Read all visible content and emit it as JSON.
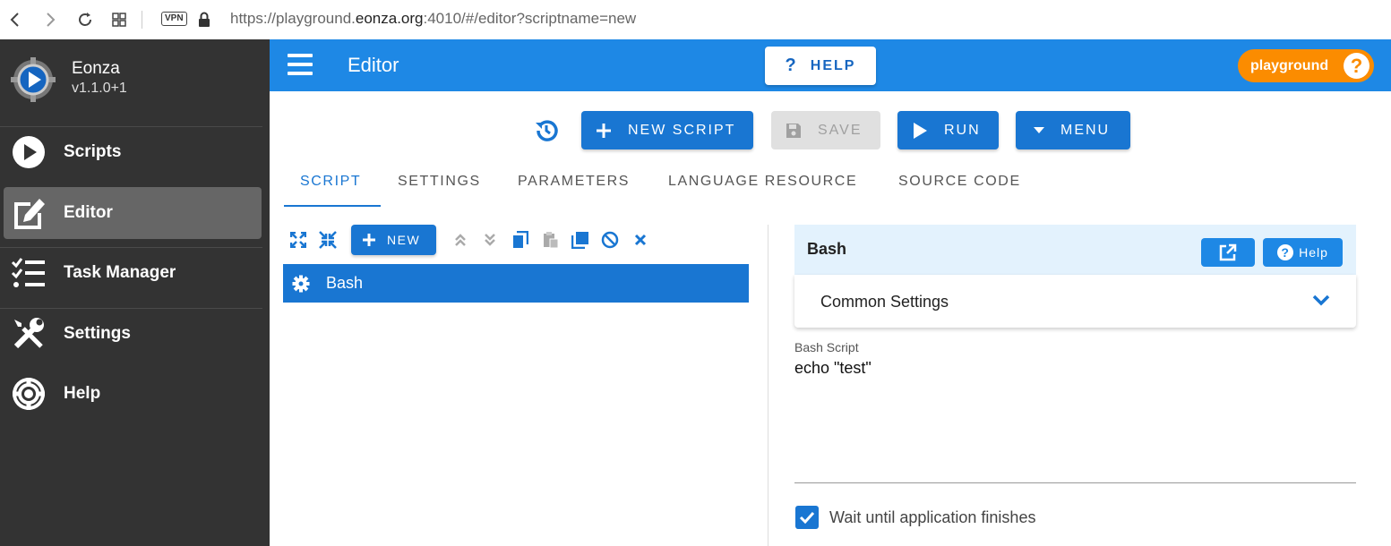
{
  "browser": {
    "url_prefix": "https://playground.",
    "url_domain": "eonza.org",
    "url_suffix": ":4010/#/editor?scriptname=new",
    "vpn_label": "VPN"
  },
  "app": {
    "name": "Eonza",
    "version": "v1.1.0+1"
  },
  "sidebar": {
    "items": [
      {
        "label": "Scripts",
        "icon": "play-circle-icon",
        "active": false
      },
      {
        "label": "Editor",
        "icon": "edit-icon",
        "active": true
      },
      {
        "label": "Task Manager",
        "icon": "checklist-icon",
        "active": false
      },
      {
        "label": "Settings",
        "icon": "tools-icon",
        "active": false
      },
      {
        "label": "Help",
        "icon": "lifebuoy-icon",
        "active": false
      }
    ]
  },
  "header": {
    "title": "Editor",
    "help_label": "HELP",
    "playground_label": "playground"
  },
  "toolbar": {
    "new_script_label": "NEW SCRIPT",
    "save_label": "SAVE",
    "run_label": "RUN",
    "menu_label": "MENU"
  },
  "tabs": [
    "SCRIPT",
    "SETTINGS",
    "PARAMETERS",
    "LANGUAGE RESOURCE",
    "SOURCE CODE"
  ],
  "tree": {
    "new_label": "NEW",
    "selected_item": "Bash"
  },
  "panel": {
    "title": "Bash",
    "help_label": "Help",
    "common_settings_label": "Common Settings",
    "field_label": "Bash Script",
    "field_value": "echo \"test\"",
    "checkbox_label": "Wait until application finishes",
    "checkbox_checked": true
  },
  "colors": {
    "primary": "#1976d2",
    "topbar": "#1e88e5",
    "sidebar": "#333333",
    "accent": "#fb8c00"
  }
}
